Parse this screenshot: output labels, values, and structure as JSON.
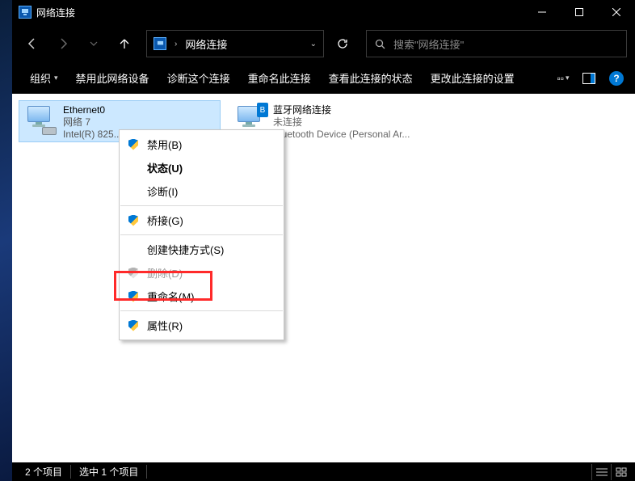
{
  "titlebar": {
    "title": "网络连接"
  },
  "nav": {
    "breadcrumb_label": "网络连接",
    "search_placeholder": "搜索\"网络连接\""
  },
  "toolbar": {
    "organize": "组织",
    "disable": "禁用此网络设备",
    "diagnose": "诊断这个连接",
    "rename": "重命名此连接",
    "status": "查看此连接的状态",
    "change_settings": "更改此连接的设置"
  },
  "connections": [
    {
      "name": "Ethernet0",
      "line2": "网络 7",
      "line3": "Intel(R) 825...",
      "selected": true,
      "type": "ethernet"
    },
    {
      "name": "蓝牙网络连接",
      "line2": "未连接",
      "line3": "Bluetooth Device (Personal Ar...",
      "selected": false,
      "type": "bluetooth"
    }
  ],
  "context_menu": {
    "items": [
      {
        "label": "禁用(B)",
        "shield": true
      },
      {
        "label": "状态(U)",
        "bold": true
      },
      {
        "label": "诊断(I)"
      },
      {
        "sep": true
      },
      {
        "label": "桥接(G)",
        "shield": true
      },
      {
        "sep": true
      },
      {
        "label": "创建快捷方式(S)"
      },
      {
        "label": "删除(D)",
        "shield": true,
        "disabled": true
      },
      {
        "label": "重命名(M)",
        "shield": true
      },
      {
        "sep": true
      },
      {
        "label": "属性(R)",
        "shield": true,
        "highlighted": true
      }
    ]
  },
  "statusbar": {
    "items_count": "2 个项目",
    "selection": "选中 1 个项目"
  }
}
